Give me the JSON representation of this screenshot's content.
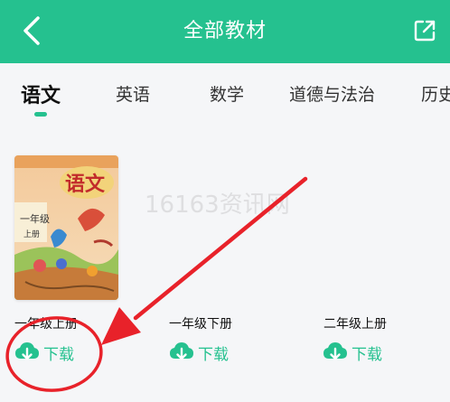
{
  "header": {
    "title": "全部教材",
    "back_icon": "back-chevron-icon",
    "share_icon": "external-share-icon",
    "color": "#25c18f"
  },
  "tabs": [
    {
      "label": "语文",
      "active": true
    },
    {
      "label": "英语",
      "active": false
    },
    {
      "label": "数学",
      "active": false
    },
    {
      "label": "道德与法治",
      "active": false
    },
    {
      "label": "历史",
      "active": false
    }
  ],
  "books": [
    {
      "name": "一年级上册",
      "download_label": "下载",
      "cover_title": "语文",
      "cover_grade": "一年级",
      "cover_volume": "上册"
    },
    {
      "name": "一年级下册",
      "download_label": "下载"
    },
    {
      "name": "二年级上册",
      "download_label": "下载"
    }
  ],
  "watermark": "16163资讯网",
  "annotation_color": "#e8222a",
  "download_icon": "cloud-download-icon"
}
